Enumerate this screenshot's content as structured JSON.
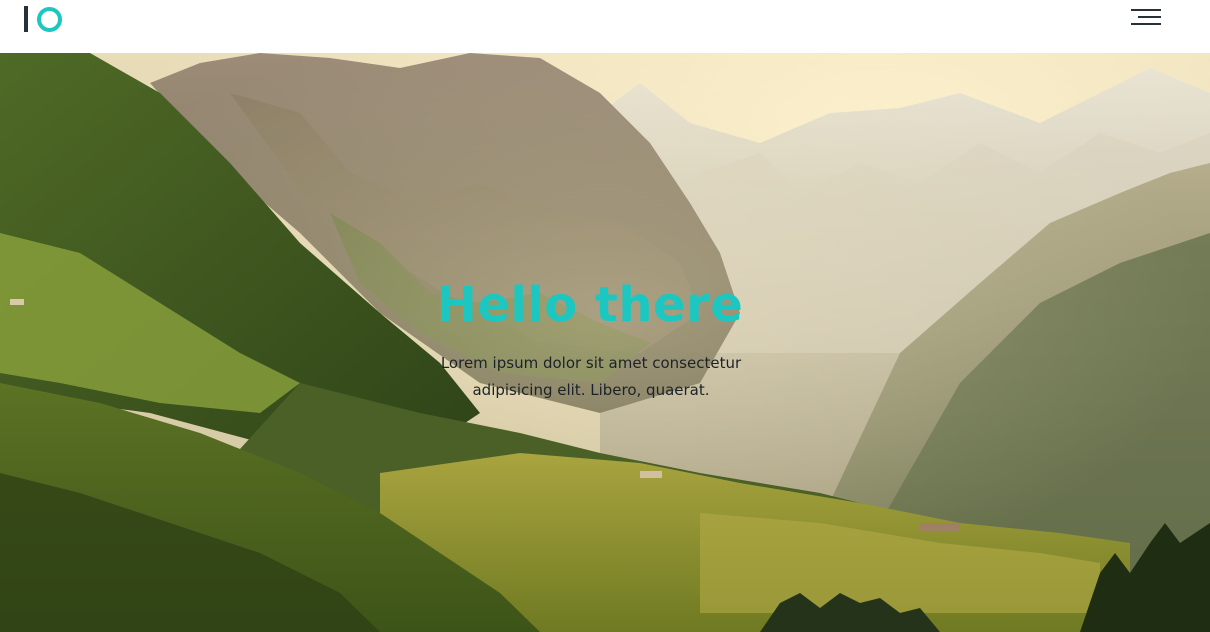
{
  "header": {
    "logo_icon": "io-logo-icon",
    "menu_icon": "hamburger-menu-icon"
  },
  "hero": {
    "background": "mountain-valley-landscape",
    "title": "Hello there",
    "text": "Lorem ipsum dolor sit amet consectetur adipisicing elit. Libero, quaerat."
  },
  "colors": {
    "accent": "#1cc7c1",
    "dark": "#263238",
    "header_bg": "#ffffff"
  }
}
